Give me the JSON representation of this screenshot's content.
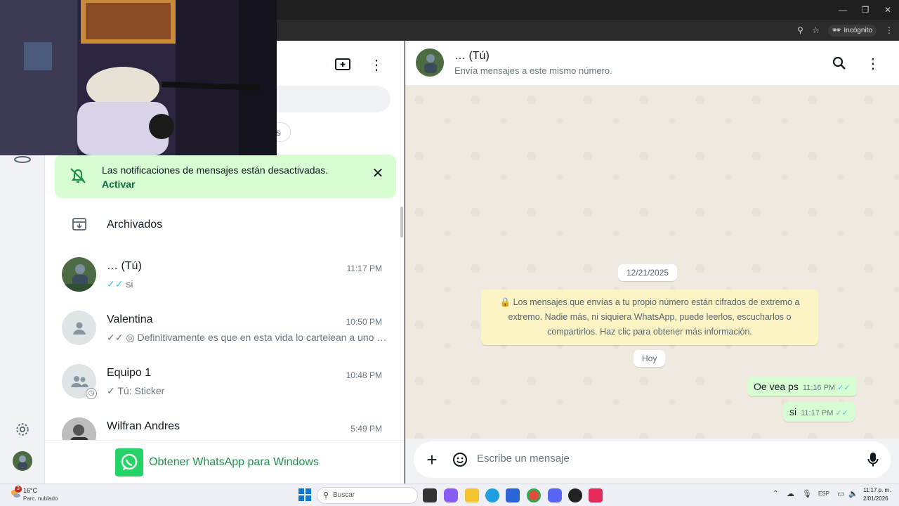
{
  "browser": {
    "incognito_label": "Incógnito",
    "zoom_icon": "zoom-icon",
    "star_icon": "star-icon"
  },
  "left": {
    "search_hint": "",
    "notification": {
      "text": "Las notificaciones de mensajes están desactivadas.",
      "action": "Activar"
    },
    "archived_label": "Archivados",
    "chats": [
      {
        "name": "… (Tú)",
        "time": "11:17 PM",
        "ticks": "✓✓",
        "message": "si"
      },
      {
        "name": "Valentina",
        "time": "10:50 PM",
        "ticks": "✓✓",
        "message": "Definitivamente es que en esta vida lo cartelean a uno …"
      },
      {
        "name": "Equipo 1",
        "time": "10:48 PM",
        "ticks": "✓",
        "message": "Tú:  Sticker"
      },
      {
        "name": "Wilfran Andres",
        "time": "5:49 PM",
        "ticks": "",
        "message": ""
      }
    ],
    "cta_label": "Obtener WhatsApp para Windows"
  },
  "chat": {
    "title": "… (Tú)",
    "subtitle": "Envía mensajes a este mismo número.",
    "date_pill": "12/21/2025",
    "system_message": "Los mensajes que envías a tu propio número están cifrados de extremo a extremo. Nadie más, ni siquiera WhatsApp, puede leerlos, escucharlos o compartirlos. Haz clic para obtener más información.",
    "today_pill": "Hoy",
    "messages": [
      {
        "text": "Oe vea ps",
        "time": "11:16 PM",
        "ticks": "✓✓"
      },
      {
        "text": "si",
        "time": "11:17 PM",
        "ticks": "✓✓"
      }
    ],
    "composer_placeholder": "Escribe un mensaje"
  },
  "taskbar": {
    "weather_temp": "16°C",
    "weather_desc": "Parc. nublado",
    "weather_badge": "3",
    "search_label": "Buscar",
    "lang": "ESP",
    "time": "11:17 p. m.",
    "date": "2/01/2026"
  }
}
